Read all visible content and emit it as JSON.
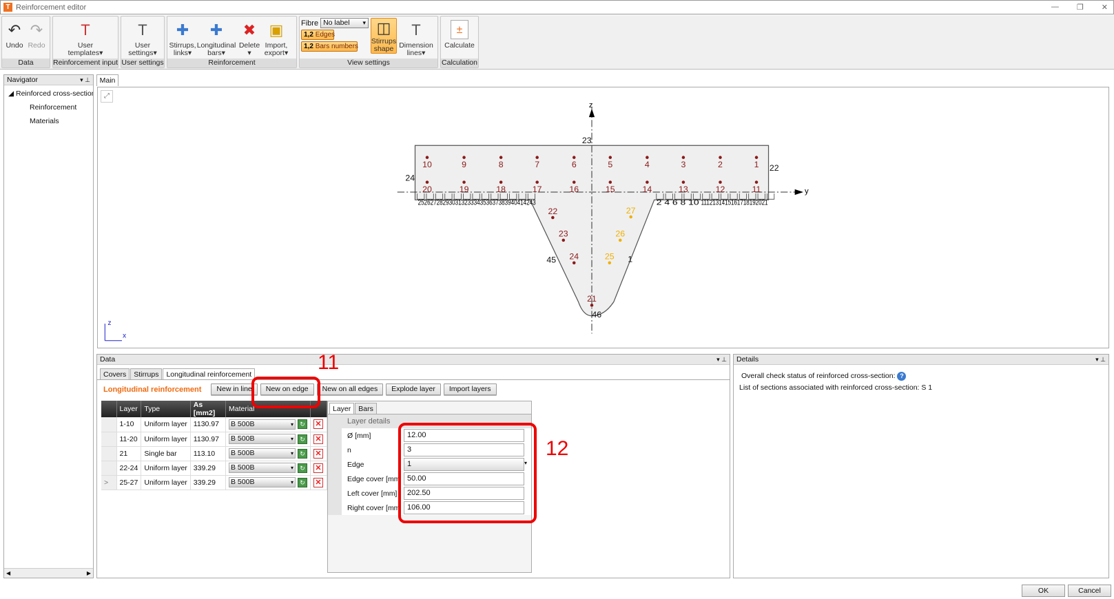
{
  "window": {
    "title": "Reinforcement editor",
    "icon": "T",
    "controls": [
      "—",
      "❐",
      "✕"
    ]
  },
  "ribbon": {
    "groups": [
      {
        "name": "Data",
        "buttons": [
          {
            "label": "Undo",
            "icon": "undo-icon",
            "enabled": true
          },
          {
            "label": "Redo",
            "icon": "redo-icon",
            "enabled": false
          }
        ]
      },
      {
        "name": "Reinforcement input",
        "buttons": [
          {
            "label": "User templates▾",
            "icon": "templates-icon"
          }
        ]
      },
      {
        "name": "User settings",
        "buttons": [
          {
            "label": "User settings▾",
            "icon": "settings-icon"
          }
        ]
      },
      {
        "name": "Reinforcement",
        "buttons": [
          {
            "label": "Stirrups, links▾",
            "icon": "stirrups-icon"
          },
          {
            "label": "Longitudinal bars▾",
            "icon": "bars-icon"
          },
          {
            "label": "Delete ▾",
            "icon": "delete-icon"
          },
          {
            "label": "Import, export▾",
            "icon": "import-icon"
          }
        ]
      },
      {
        "name": "View settings",
        "fibre_label": "Fibre",
        "fibre_value": "No label",
        "tag_num": "1,2",
        "edges": "Edges",
        "bars_numbers": "Bars numbers",
        "buttons": [
          {
            "label": "Stirrups shape",
            "icon": "stirrups-shape-icon",
            "active": true
          },
          {
            "label": "Dimension lines▾",
            "icon": "dimension-icon"
          }
        ]
      },
      {
        "name": "Calculation",
        "buttons": [
          {
            "label": "Calculate",
            "icon": "calculator-icon"
          }
        ]
      }
    ]
  },
  "navigator": {
    "title": "Navigator",
    "root": "Reinforced cross-section",
    "items": [
      "Reinforcement",
      "Materials"
    ]
  },
  "main": {
    "tab": "Main",
    "axes": {
      "y": "y",
      "z": "z",
      "x": "x"
    },
    "edges": {
      "top": "23",
      "right": "22",
      "left": "24",
      "web_left": "45",
      "web_right": "1",
      "tip": "46",
      "bottom_left": "25262728293031323334353637383940414243",
      "bottom_right_a": "2 4 6 8 10",
      "bottom_right_b": "1112131415161718192021"
    },
    "bars_top": [
      "10",
      "9",
      "8",
      "7",
      "6",
      "5",
      "4",
      "3",
      "2",
      "1"
    ],
    "bars_second": [
      "20",
      "19",
      "18",
      "17",
      "16",
      "15",
      "14",
      "13",
      "12",
      "11"
    ],
    "bars_web_left": [
      "22",
      "23",
      "24"
    ],
    "bars_tip": [
      "21"
    ],
    "bars_web_right": [
      "27",
      "26",
      "25"
    ],
    "colors": {
      "bar": "#8b1a1a",
      "selected": "#f0b000",
      "section": "#efefef"
    }
  },
  "data_panel": {
    "title": "Data",
    "tabs": [
      "Covers",
      "Stirrups",
      "Longitudinal reinforcement"
    ],
    "heading": "Longitudinal reinforcement",
    "actions": [
      "New in line",
      "New on edge",
      "New on all edges",
      "Explode layer",
      "Import layers"
    ],
    "columns": [
      "Layer",
      "Type",
      "As [mm2]",
      "Material"
    ],
    "rows": [
      {
        "layer": "1-10",
        "type": "Uniform layer",
        "as": "1130.97",
        "material": "B 500B"
      },
      {
        "layer": "11-20",
        "type": "Uniform layer",
        "as": "1130.97",
        "material": "B 500B"
      },
      {
        "layer": "21",
        "type": "Single bar",
        "as": "113.10",
        "material": "B 500B"
      },
      {
        "layer": "22-24",
        "type": "Uniform layer",
        "as": "339.29",
        "material": "B 500B"
      },
      {
        "layer": "25-27",
        "type": "Uniform layer",
        "as": "339.29",
        "material": "B 500B",
        "current": ">"
      }
    ],
    "detail_tabs": [
      "Layer",
      "Bars"
    ],
    "detail_title": "Layer details",
    "props": [
      {
        "label": "Ø [mm]",
        "value": "12.00"
      },
      {
        "label": "n",
        "value": "3"
      },
      {
        "label": "Edge",
        "value": "1"
      },
      {
        "label": "Edge cover [mm]",
        "value": "50.00"
      },
      {
        "label": "Left cover [mm]",
        "value": "202.50"
      },
      {
        "label": "Right cover [mm]",
        "value": "106.00"
      }
    ]
  },
  "annotations": {
    "a11": "11",
    "a12": "12"
  },
  "details": {
    "title": "Details",
    "line1": "Overall check status of reinforced cross-section:",
    "line2": "List of sections associated with reinforced cross-section: S 1"
  },
  "footer": {
    "ok": "OK",
    "cancel": "Cancel"
  }
}
